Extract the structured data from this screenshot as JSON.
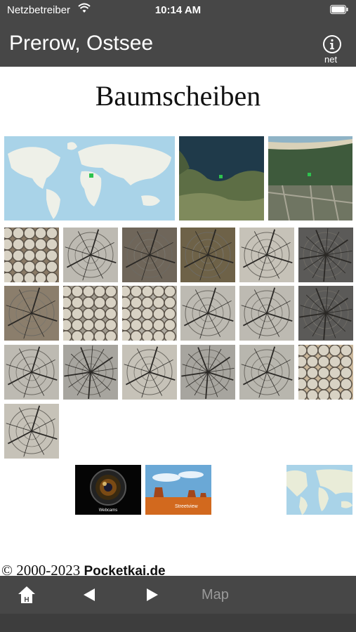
{
  "status_bar": {
    "carrier": "Netzbetreiber",
    "time": "10:14 AM"
  },
  "nav": {
    "title": "Prerow, Ostsee",
    "info_label": "net"
  },
  "page": {
    "heading": "Baumscheiben"
  },
  "links": {
    "webcams_label": "Webcams",
    "streetview_label": "Streetview"
  },
  "footer": {
    "copyright": "© 2000-2023 ",
    "brand": "Pocketkai.de"
  },
  "toolbar": {
    "map_label": "Map",
    "home_letter": "H"
  },
  "colors": {
    "bar": "#474747",
    "water": "#a9d3e8",
    "land": "#eef0e8"
  }
}
